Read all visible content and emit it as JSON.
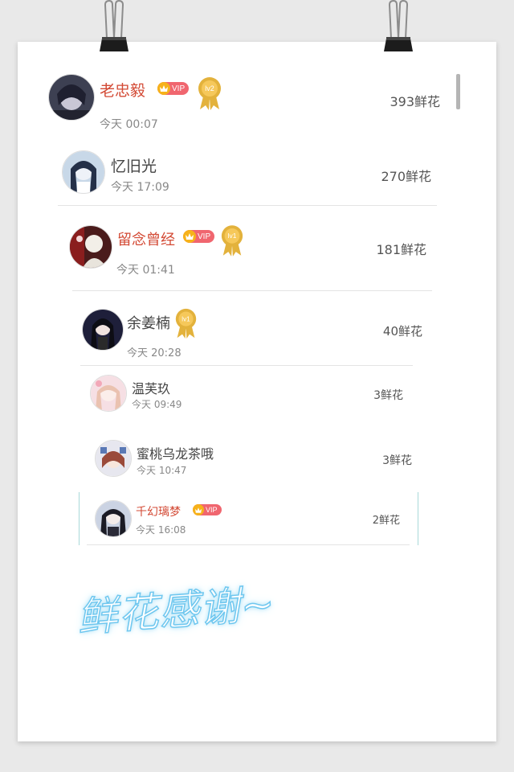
{
  "entries": [
    {
      "name": "老忠毅",
      "time": "今天 00:07",
      "flowers": "393鲜花",
      "vip_label": "VIP",
      "level": "lv2"
    },
    {
      "name": "忆旧光",
      "time": "今天 17:09",
      "flowers": "270鲜花"
    },
    {
      "name": "留念曾经",
      "time": "今天 01:41",
      "flowers": "181鲜花",
      "vip_label": "VIP",
      "level": "lv1"
    },
    {
      "name": "余姜楠",
      "time": "今天 20:28",
      "flowers": "40鲜花",
      "level": "lv1"
    },
    {
      "name": "温芙玖",
      "time": "今天 09:49",
      "flowers": "3鲜花"
    },
    {
      "name": "蜜桃乌龙茶哦",
      "time": "今天 10:47",
      "flowers": "3鲜花"
    },
    {
      "name": "千幻璃梦",
      "time": "今天 16:08",
      "flowers": "2鲜花",
      "vip_label": "VIP"
    }
  ],
  "thanks_text": "鲜花感谢~",
  "colors": {
    "vip_name": "#d34a35",
    "vip_badge": "#f0666f",
    "crown": "#f6b21a",
    "medal": "#e3b23c",
    "glow": "#6fc7ef"
  }
}
